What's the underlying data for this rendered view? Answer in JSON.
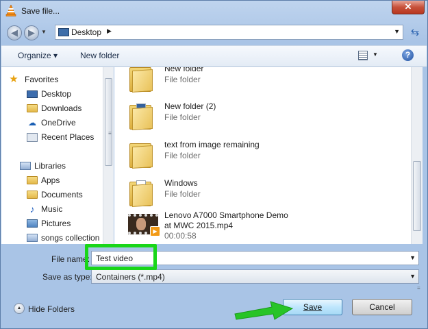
{
  "window": {
    "title": "Save file...",
    "close_glyph": "✕",
    "app_icon": "vlc-cone-icon"
  },
  "address": {
    "location": "Desktop",
    "separator": "▶",
    "dropdown": "▼",
    "refresh": "⇆",
    "back_glyph": "◀",
    "forward_glyph": "▶"
  },
  "toolbar": {
    "organize": "Organize ▾",
    "new_folder": "New folder",
    "view_drop": "▼",
    "help": "?"
  },
  "nav_pane": {
    "favorites": {
      "label": "Favorites",
      "items": [
        {
          "label": "Desktop",
          "icon": "desktop-icon"
        },
        {
          "label": "Downloads",
          "icon": "downloads-folder-icon"
        },
        {
          "label": "OneDrive",
          "icon": "onedrive-cloud-icon"
        },
        {
          "label": "Recent Places",
          "icon": "recent-places-icon"
        }
      ]
    },
    "libraries": {
      "label": "Libraries",
      "items": [
        {
          "label": "Apps",
          "icon": "folder-icon"
        },
        {
          "label": "Documents",
          "icon": "documents-icon"
        },
        {
          "label": "Music",
          "icon": "music-icon"
        },
        {
          "label": "Pictures",
          "icon": "pictures-icon"
        },
        {
          "label": "songs collection",
          "icon": "library-icon"
        }
      ]
    }
  },
  "files": [
    {
      "name": "New folder",
      "type": "File folder",
      "kind": "folder"
    },
    {
      "name": "New folder (2)",
      "type": "File folder",
      "kind": "folder"
    },
    {
      "name": "text from image remaining",
      "type": "File folder",
      "kind": "folder"
    },
    {
      "name": "Windows",
      "type": "File folder",
      "kind": "folder"
    },
    {
      "name": "Lenovo A7000 Smartphone Demo",
      "name2": "at MWC 2015.mp4",
      "duration": "00:00:58",
      "kind": "video"
    }
  ],
  "form": {
    "file_name_label": "File name:",
    "file_name_value": "Test video",
    "save_type_label": "Save as type:",
    "save_type_value": "Containers (*.mp4)",
    "dropdown": "▼"
  },
  "footer": {
    "hide_folders": "Hide Folders",
    "hide_glyph": "▲",
    "save": "Save",
    "cancel": "Cancel"
  },
  "colors": {
    "highlight_box": "#19d619",
    "arrow": "#27c427"
  }
}
